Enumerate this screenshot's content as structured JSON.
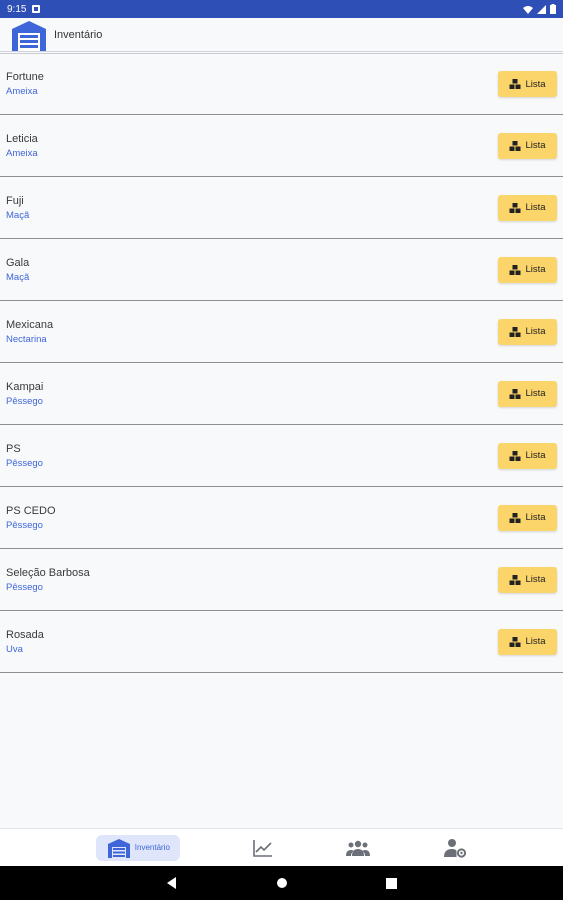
{
  "status_bar": {
    "time": "9:15"
  },
  "header": {
    "title": "Inventário"
  },
  "items": [
    {
      "name": "Fortune",
      "type": "Ameixa",
      "button": "Lista"
    },
    {
      "name": "Leticia",
      "type": "Ameixa",
      "button": "Lista"
    },
    {
      "name": "Fuji",
      "type": "Maçã",
      "button": "Lista"
    },
    {
      "name": "Gala",
      "type": "Maçã",
      "button": "Lista"
    },
    {
      "name": "Mexicana",
      "type": "Nectarina",
      "button": "Lista"
    },
    {
      "name": "Kampai",
      "type": "Pêssego",
      "button": "Lista"
    },
    {
      "name": "PS",
      "type": "Pêssego",
      "button": "Lista"
    },
    {
      "name": "PS CEDO",
      "type": "Pêssego",
      "button": "Lista"
    },
    {
      "name": "Seleção Barbosa",
      "type": "Pêssego",
      "button": "Lista"
    },
    {
      "name": "Rosada",
      "type": "Uva",
      "button": "Lista"
    }
  ],
  "bottom_nav": {
    "active_label": "Inventário",
    "icons": [
      "warehouse-icon",
      "chart-icon",
      "group-icon",
      "user-settings-icon"
    ]
  },
  "colors": {
    "status_bar": "#2d4fb6",
    "accent": "#3f66d8",
    "button": "#fbd46a"
  }
}
